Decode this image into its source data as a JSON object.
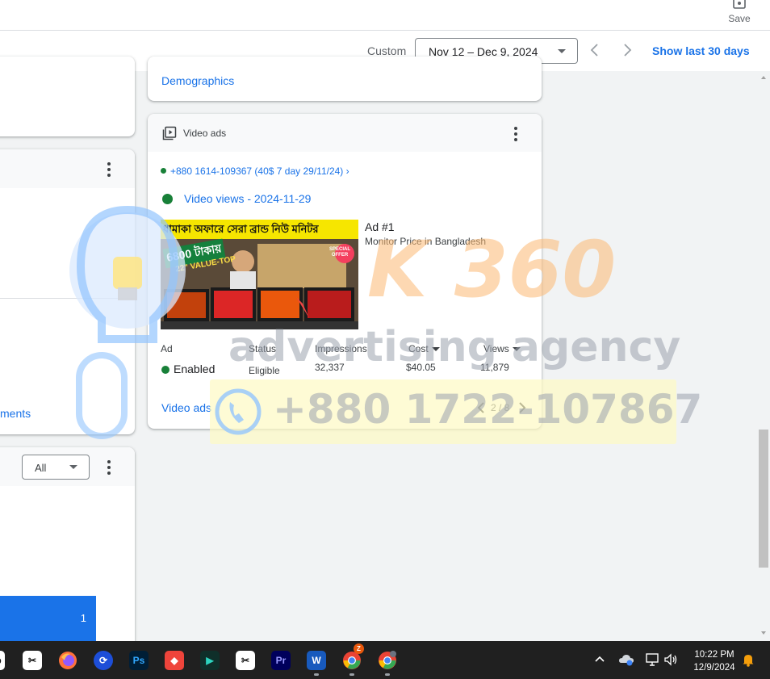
{
  "toolbar": {
    "save_label": "Save",
    "custom_label": "Custom",
    "date_range": "Nov 12 – Dec 9, 2024",
    "show_last_label": "Show last 30 days"
  },
  "left_cards": {
    "link_partial": "ments",
    "filter_value": "All",
    "bar_value": "1"
  },
  "demographics_link": "Demographics",
  "video_ads": {
    "title": "Video ads",
    "campaign": "+880 1614-109367 (40$ 7 day 29/11/24) ›",
    "ad_group": "Video views - 2024-11-29",
    "ad_number": "Ad #1",
    "ad_title": "Monitor Price in Bangladesh",
    "thumbnail_text": {
      "headline": "ধামাকা অফারে সেরা ব্রান্ড নিউ মনিটর",
      "price": "6800 টাকায়",
      "size": "22\" VALUE-TOP",
      "badge": "SPECIAL OFFER"
    },
    "columns": {
      "ad": "Ad",
      "status": "Status",
      "impressions": "Impressions",
      "cost": "Cost",
      "views": "Views"
    },
    "row": {
      "ad_status": "Enabled",
      "status": "Eligible",
      "impressions": "32,337",
      "cost": "$40.05",
      "views": "11,879"
    },
    "footer_link": "Video ads",
    "pager": "2 / 8"
  },
  "watermark": {
    "line1": "K 360",
    "line2": "advertising agency",
    "phone": "+880 1722-107867"
  },
  "taskbar": {
    "apps": [
      "capcut-1",
      "firefox",
      "sync",
      "photoshop",
      "anydesk",
      "filmora",
      "capcut-2",
      "premiere",
      "word",
      "chrome",
      "chrome-2"
    ],
    "chrome_badge": "Z",
    "time": "10:22 PM",
    "date": "12/9/2024"
  },
  "colors": {
    "accent": "#1a73e8",
    "status_green": "#188038",
    "taskbar": "#202020"
  }
}
